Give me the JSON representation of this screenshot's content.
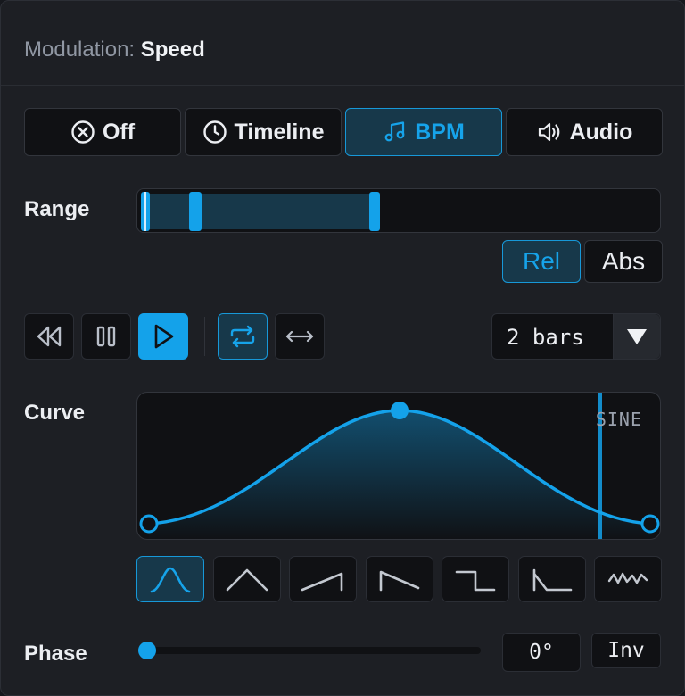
{
  "header": {
    "label": "Modulation:",
    "value": "Speed"
  },
  "modes": [
    {
      "label": "Off",
      "icon": "close-circle-icon",
      "active": false
    },
    {
      "label": "Timeline",
      "icon": "clock-icon",
      "active": false
    },
    {
      "label": "BPM",
      "icon": "music-note-icon",
      "active": true
    },
    {
      "label": "Audio",
      "icon": "speaker-icon",
      "active": false
    }
  ],
  "range": {
    "label": "Range",
    "buttons": [
      {
        "label": "Rel",
        "active": true
      },
      {
        "label": "Abs",
        "active": false
      }
    ]
  },
  "transport": {
    "buttons": [
      {
        "name": "rewind",
        "icon": "rewind-icon",
        "active": false
      },
      {
        "name": "pause",
        "icon": "pause-icon",
        "active": false
      },
      {
        "name": "play",
        "icon": "play-icon",
        "active": true
      },
      {
        "name": "loop",
        "icon": "loop-icon",
        "active": true
      },
      {
        "name": "ping-pong",
        "icon": "double-arrow-icon",
        "active": false
      }
    ],
    "duration": {
      "value": "2 bars",
      "icon": "triangle-down-icon"
    }
  },
  "curve": {
    "label": "Curve",
    "type": "SINE",
    "shapes": [
      {
        "name": "sine",
        "icon": "sine-bump-icon",
        "active": true
      },
      {
        "name": "triangle",
        "icon": "triangle-icon",
        "active": false
      },
      {
        "name": "ramp-up",
        "icon": "ramp-up-icon",
        "active": false
      },
      {
        "name": "ramp-down",
        "icon": "ramp-down-icon",
        "active": false
      },
      {
        "name": "square",
        "icon": "square-step-icon",
        "active": false
      },
      {
        "name": "decay",
        "icon": "decay-icon",
        "active": false
      },
      {
        "name": "noise",
        "icon": "noise-icon",
        "active": false
      }
    ]
  },
  "phase": {
    "label": "Phase",
    "value": "0°",
    "fraction": 0.0,
    "invert_label": "Inv"
  },
  "colors": {
    "accent": "#14a2ea",
    "accent_bg": "#17384a",
    "panel": "#1d1f24",
    "field": "#101114"
  }
}
